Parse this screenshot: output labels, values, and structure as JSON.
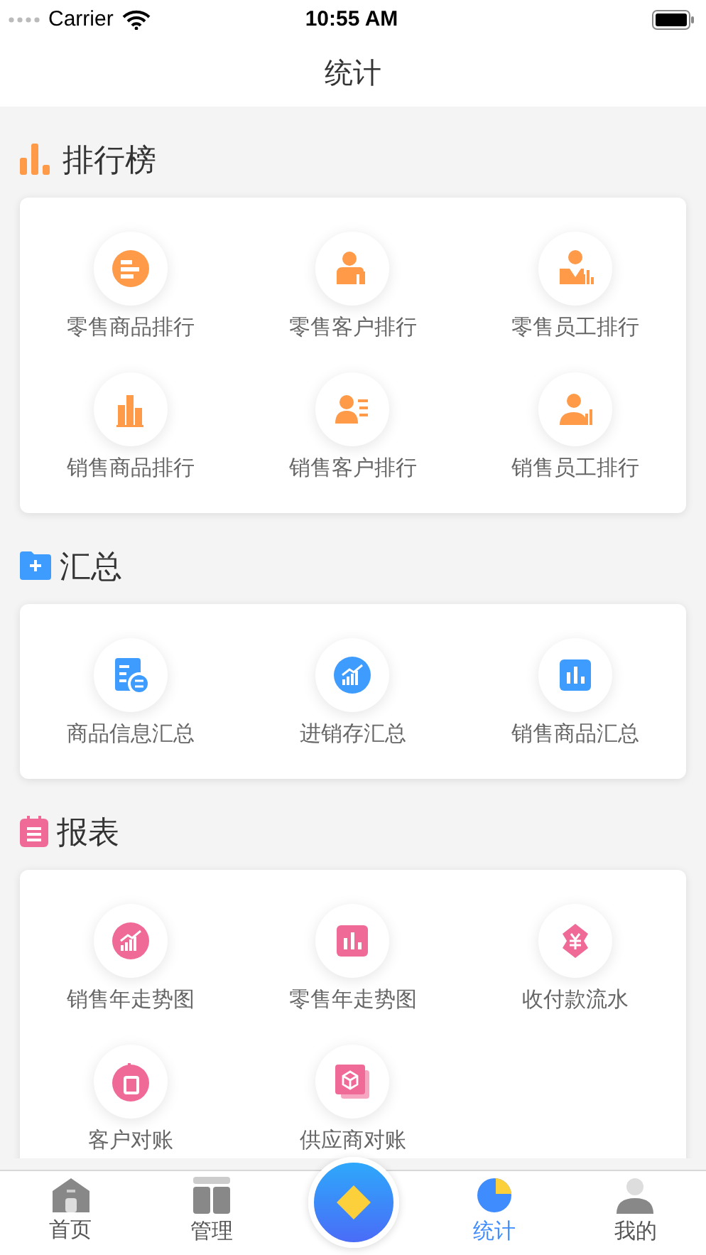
{
  "status_bar": {
    "carrier": "Carrier",
    "time": "10:55 AM"
  },
  "nav": {
    "title": "统计"
  },
  "sections": [
    {
      "kind": "ranking",
      "title": "排行榜",
      "items": [
        {
          "kind": "list-circle",
          "label": "零售商品排行"
        },
        {
          "kind": "person-chart",
          "label": "零售客户排行"
        },
        {
          "kind": "tie-chart",
          "label": "零售员工排行"
        },
        {
          "kind": "bars",
          "label": "销售商品排行"
        },
        {
          "kind": "person-list",
          "label": "销售客户排行"
        },
        {
          "kind": "bust-chart",
          "label": "销售员工排行"
        }
      ]
    },
    {
      "kind": "summary",
      "title": "汇总",
      "items": [
        {
          "kind": "doc-swap",
          "label": "商品信息汇总"
        },
        {
          "kind": "trend-circle",
          "label": "进销存汇总"
        },
        {
          "kind": "bars-square",
          "label": "销售商品汇总"
        }
      ]
    },
    {
      "kind": "report",
      "title": "报表",
      "items": [
        {
          "kind": "trend-circle",
          "label": "销售年走势图"
        },
        {
          "kind": "bars-square",
          "label": "零售年走势图"
        },
        {
          "kind": "yen",
          "label": "收付款流水"
        },
        {
          "kind": "doc-circle",
          "label": "客户对账"
        },
        {
          "kind": "box",
          "label": "供应商对账"
        }
      ]
    }
  ],
  "tabs": [
    {
      "kind": "home",
      "label": "首页",
      "selected": false
    },
    {
      "kind": "grid",
      "label": "管理",
      "selected": false
    },
    {
      "kind": "center"
    },
    {
      "kind": "pie",
      "label": "统计",
      "selected": true
    },
    {
      "kind": "user",
      "label": "我的",
      "selected": false
    }
  ]
}
